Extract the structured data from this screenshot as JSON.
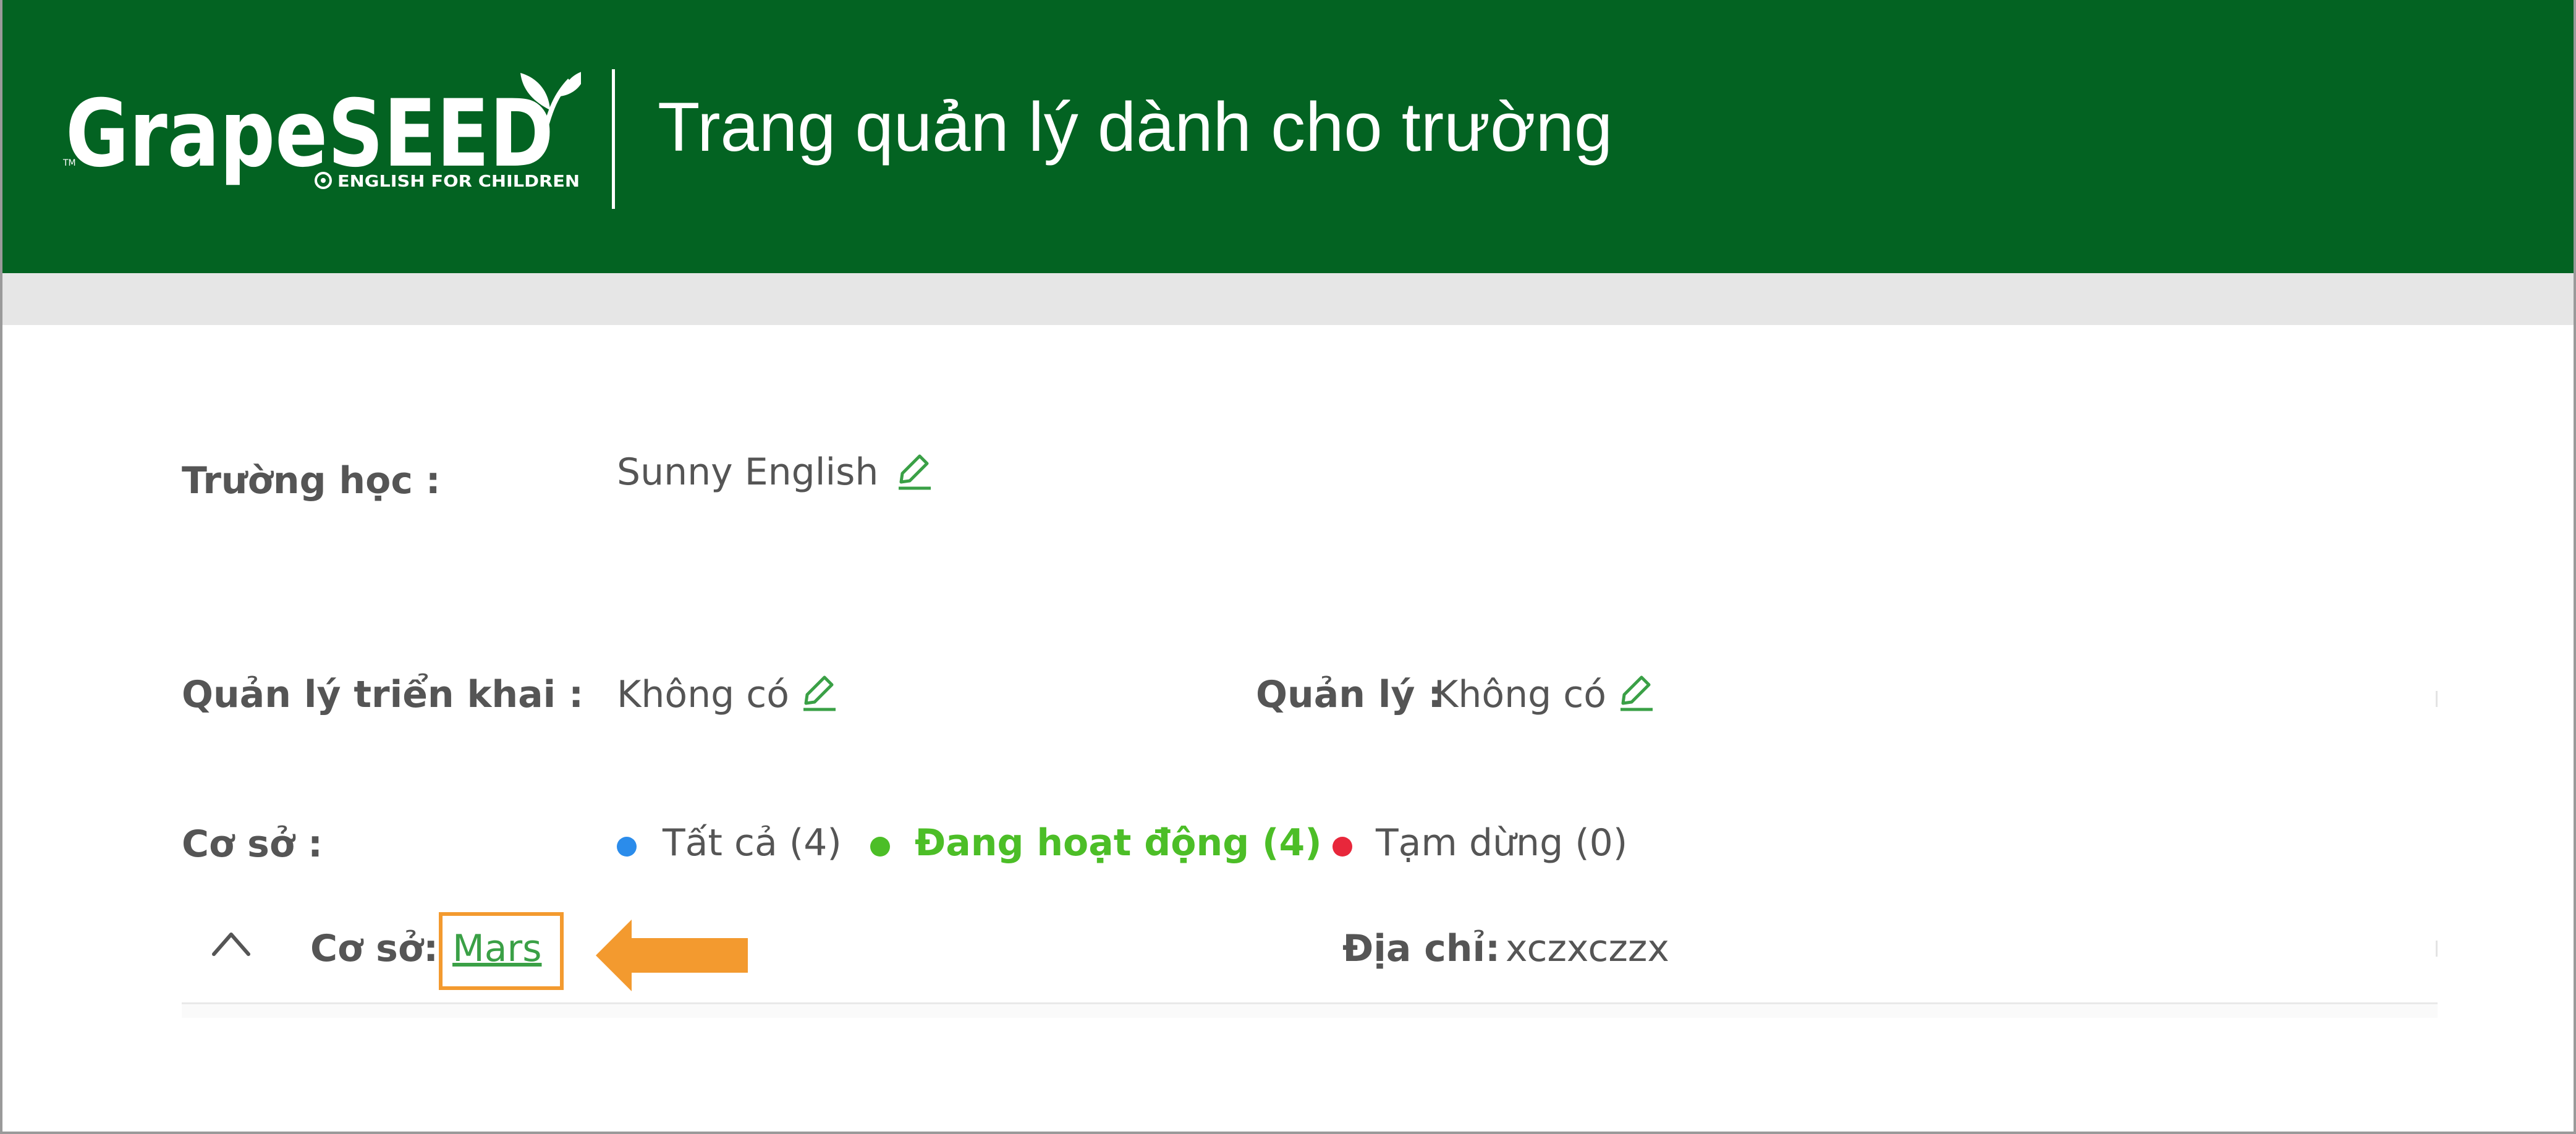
{
  "header": {
    "logo_text": "GrapeSEED",
    "logo_tagline": "ENGLISH FOR CHILDREN",
    "logo_trademark": "TM",
    "title": "Trang quản lý dành cho trường"
  },
  "school": {
    "label": "Trường học :",
    "value": "Sunny English"
  },
  "management": {
    "implementation_label": "Quản lý triển khai :",
    "implementation_value": "Không có",
    "manager_label": "Quản lý :",
    "manager_value": "Không có"
  },
  "campus_filter": {
    "label": "Cơ sở :",
    "options": [
      {
        "label": "Tất cả (4)",
        "color": "#2b8ceb"
      },
      {
        "label": "Đang hoạt động (4)",
        "color": "#4cbe27",
        "active": true
      },
      {
        "label": "Tạm dừng (0)",
        "color": "#e8273b"
      }
    ]
  },
  "campus_row": {
    "campus_label": "Cơ sở:",
    "campus_name": "Mars",
    "address_label": "Địa chỉ:",
    "address_value": "xczxczzx"
  },
  "colors": {
    "header_green": "#036322",
    "highlight_orange": "#f39a2f",
    "link_green": "#3aa046"
  }
}
